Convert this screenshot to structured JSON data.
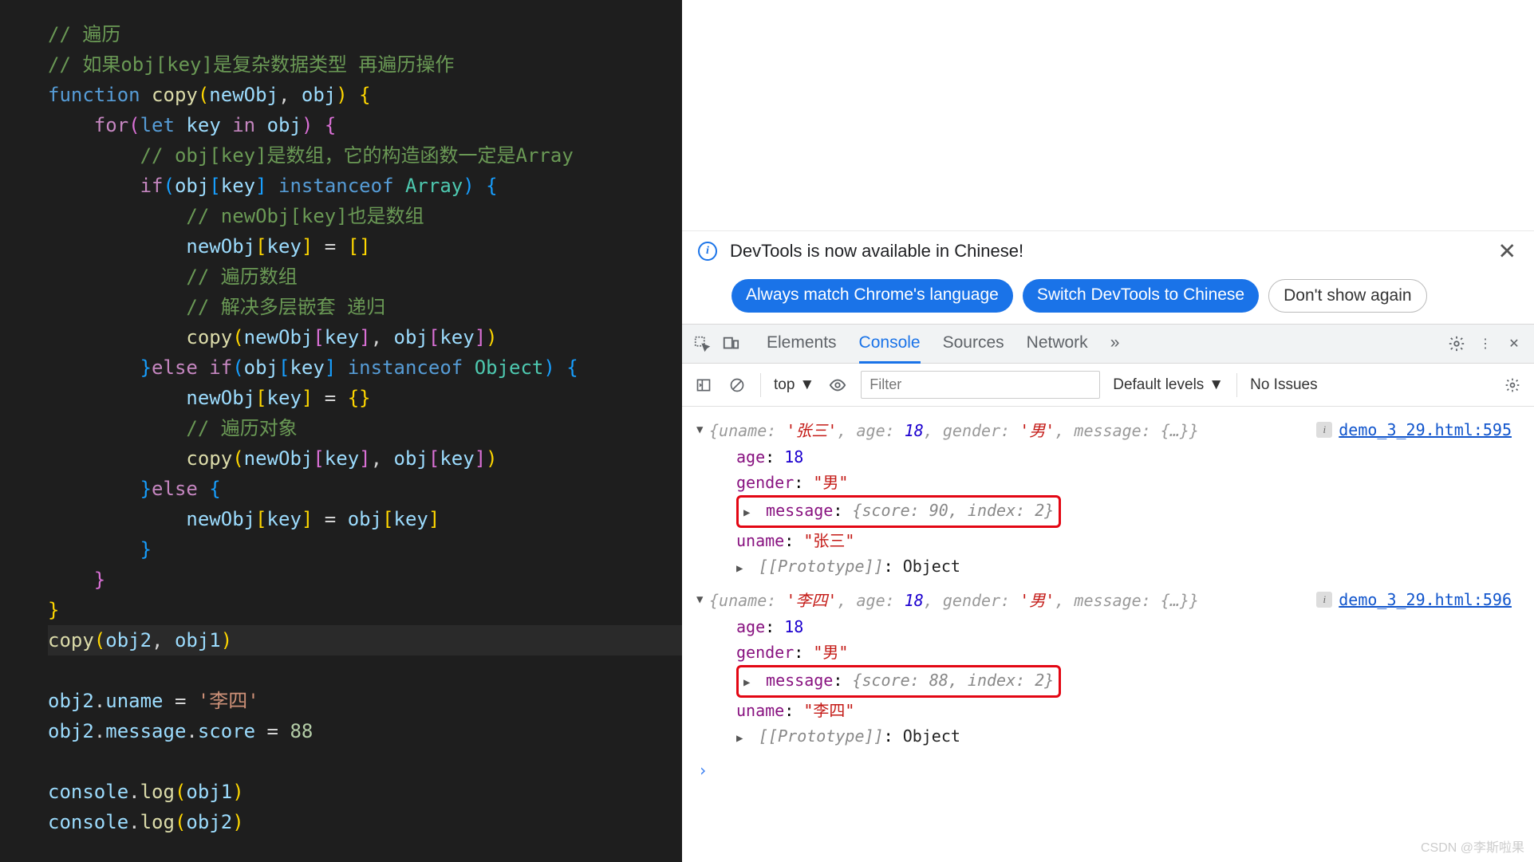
{
  "code": {
    "l1": "// 遍历",
    "l2": "// 如果obj[key]是复杂数据类型 再遍历操作",
    "l3": {
      "kw": "function",
      "fn": "copy",
      "p1": "newObj",
      "p2": "obj"
    },
    "l4": {
      "kw": "for",
      "let": "let",
      "v": "key",
      "in": "in",
      "obj": "obj"
    },
    "l5": "// obj[key]是数组，它的构造函数一定是Array",
    "l6": {
      "if": "if",
      "obj": "obj",
      "key": "key",
      "op": "instanceof",
      "type": "Array"
    },
    "l7": "// newObj[key]也是数组",
    "l8": {
      "a": "newObj",
      "b": "key"
    },
    "l9": "// 遍历数组",
    "l10": "// 解决多层嵌套 递归",
    "l11": {
      "fn": "copy",
      "a": "newObj",
      "b": "key",
      "c": "obj",
      "d": "key"
    },
    "l12": {
      "else": "else",
      "if": "if",
      "obj": "obj",
      "key": "key",
      "op": "instanceof",
      "type": "Object"
    },
    "l13": {
      "a": "newObj",
      "b": "key"
    },
    "l14": "// 遍历对象",
    "l15": {
      "fn": "copy",
      "a": "newObj",
      "b": "key",
      "c": "obj",
      "d": "key"
    },
    "l16": {
      "else": "else"
    },
    "l17": {
      "a": "newObj",
      "b": "key",
      "c": "obj",
      "d": "key"
    },
    "l18": {
      "fn": "copy",
      "a": "obj2",
      "b": "obj1"
    },
    "l19": {
      "a": "obj2",
      "b": "uname",
      "v": "'李四'"
    },
    "l20": {
      "a": "obj2",
      "b": "message",
      "c": "score",
      "v": "88"
    },
    "l21": {
      "a": "console",
      "fn": "log",
      "v": "obj1"
    },
    "l22": {
      "a": "console",
      "fn": "log",
      "v": "obj2"
    }
  },
  "banner": {
    "text": "DevTools is now available in Chinese!",
    "btn1": "Always match Chrome's language",
    "btn2": "Switch DevTools to Chinese",
    "btn3": "Don't show again"
  },
  "tabs": {
    "t1": "Elements",
    "t2": "Console",
    "t3": "Sources",
    "t4": "Network"
  },
  "toolbar": {
    "ctx": "top",
    "filter": "Filter",
    "levels": "Default levels",
    "issues": "No Issues"
  },
  "console_logs": [
    {
      "summary": {
        "uname": "'张三'",
        "age": "18",
        "gender": "'男'",
        "msg": "{…}"
      },
      "source": "demo_3_29.html:595",
      "props": {
        "age": "18",
        "gender": "\"男\"",
        "message": "{score: 90, index: 2}",
        "uname": "\"张三\"",
        "proto": "Object"
      }
    },
    {
      "summary": {
        "uname": "'李四'",
        "age": "18",
        "gender": "'男'",
        "msg": "{…}"
      },
      "source": "demo_3_29.html:596",
      "props": {
        "age": "18",
        "gender": "\"男\"",
        "message": "{score: 88, index: 2}",
        "uname": "\"李四\"",
        "proto": "Object"
      }
    }
  ],
  "watermark": "CSDN @李斯啦果"
}
